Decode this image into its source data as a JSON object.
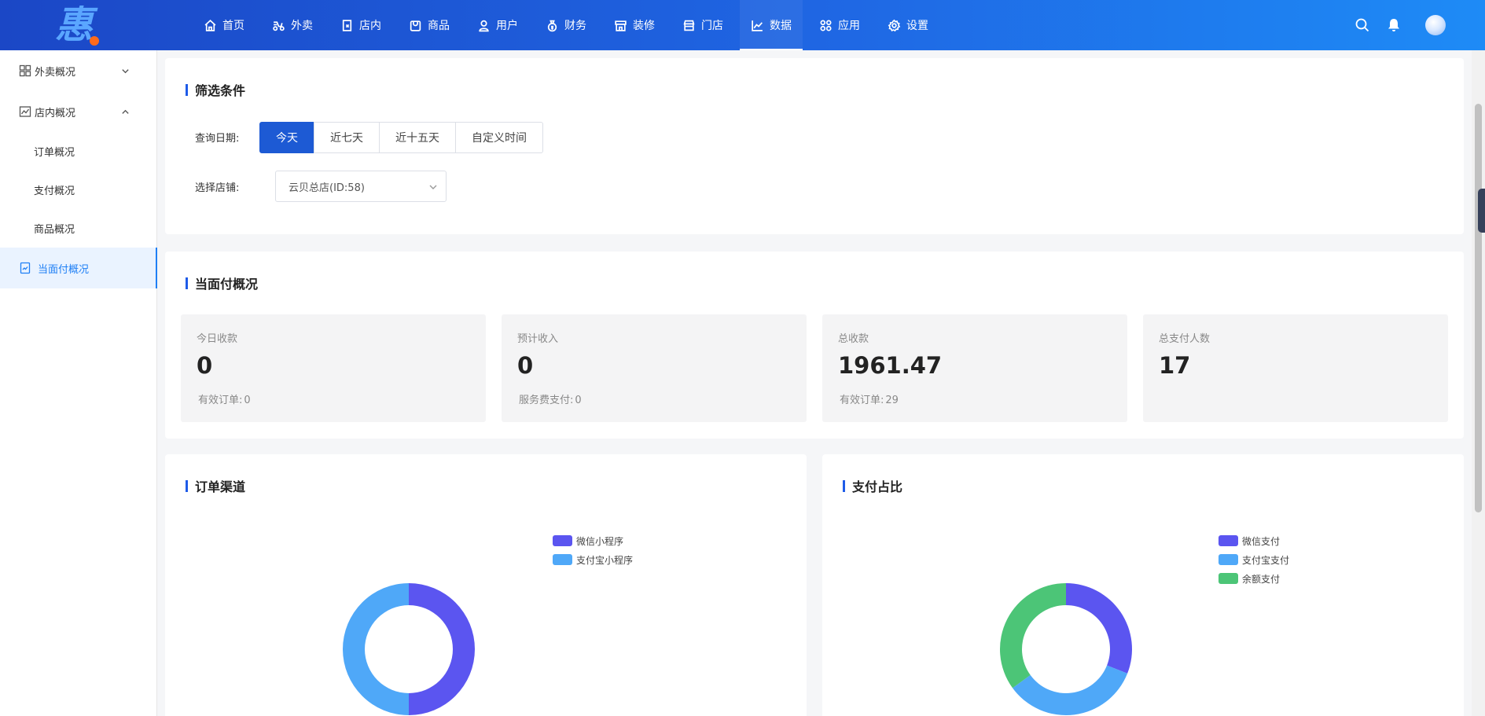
{
  "header": {
    "logo_text": "惠",
    "nav": [
      {
        "label": "首页",
        "icon": "home-icon"
      },
      {
        "label": "外卖",
        "icon": "scooter-icon"
      },
      {
        "label": "店内",
        "icon": "store-in-icon"
      },
      {
        "label": "商品",
        "icon": "goods-icon"
      },
      {
        "label": "用户",
        "icon": "user-icon"
      },
      {
        "label": "财务",
        "icon": "money-bag-icon"
      },
      {
        "label": "装修",
        "icon": "decoration-icon"
      },
      {
        "label": "门店",
        "icon": "shop-icon"
      },
      {
        "label": "数据",
        "icon": "line-chart-icon",
        "active": true
      },
      {
        "label": "应用",
        "icon": "apps-icon"
      },
      {
        "label": "设置",
        "icon": "gear-icon"
      }
    ]
  },
  "sidebar": {
    "groups": [
      {
        "label": "外卖概况",
        "expanded": false
      },
      {
        "label": "店内概况",
        "expanded": true,
        "children": [
          "订单概况",
          "支付概况",
          "商品概况"
        ]
      }
    ],
    "active_item": "当面付概况"
  },
  "filter": {
    "title": "筛选条件",
    "date_label": "查询日期:",
    "date_options": [
      "今天",
      "近七天",
      "近十五天",
      "自定义时间"
    ],
    "date_selected": "今天",
    "store_label": "选择店铺:",
    "store_selected": "云贝总店(ID:58)"
  },
  "overview": {
    "title": "当面付概况",
    "stats": [
      {
        "label": "今日收款",
        "value": "0",
        "sub_label": "有效订单:",
        "sub_value": "0"
      },
      {
        "label": "预计收入",
        "value": "0",
        "sub_label": "服务费支付:",
        "sub_value": "0"
      },
      {
        "label": "总收款",
        "value": "1961.47",
        "sub_label": "有效订单:",
        "sub_value": "29"
      },
      {
        "label": "总支付人数",
        "value": "17",
        "sub_label": "",
        "sub_value": ""
      }
    ]
  },
  "chart_data": [
    {
      "type": "pie",
      "donut": true,
      "title": "订单渠道",
      "legend_position": "top-right",
      "categories": [
        "微信小程序",
        "支付宝小程序"
      ],
      "values": [
        50,
        50
      ],
      "colors": [
        "#5b55f0",
        "#4fa8f8"
      ]
    },
    {
      "type": "pie",
      "donut": true,
      "title": "支付占比",
      "legend_position": "top-right",
      "categories": [
        "微信支付",
        "支付宝支付",
        "余额支付"
      ],
      "values": [
        31,
        34,
        35
      ],
      "colors": [
        "#5b55f0",
        "#4fa8f8",
        "#4cc577"
      ]
    }
  ],
  "colors": {
    "primary": "#1d5ad4",
    "accent": "#1e7ff5"
  }
}
